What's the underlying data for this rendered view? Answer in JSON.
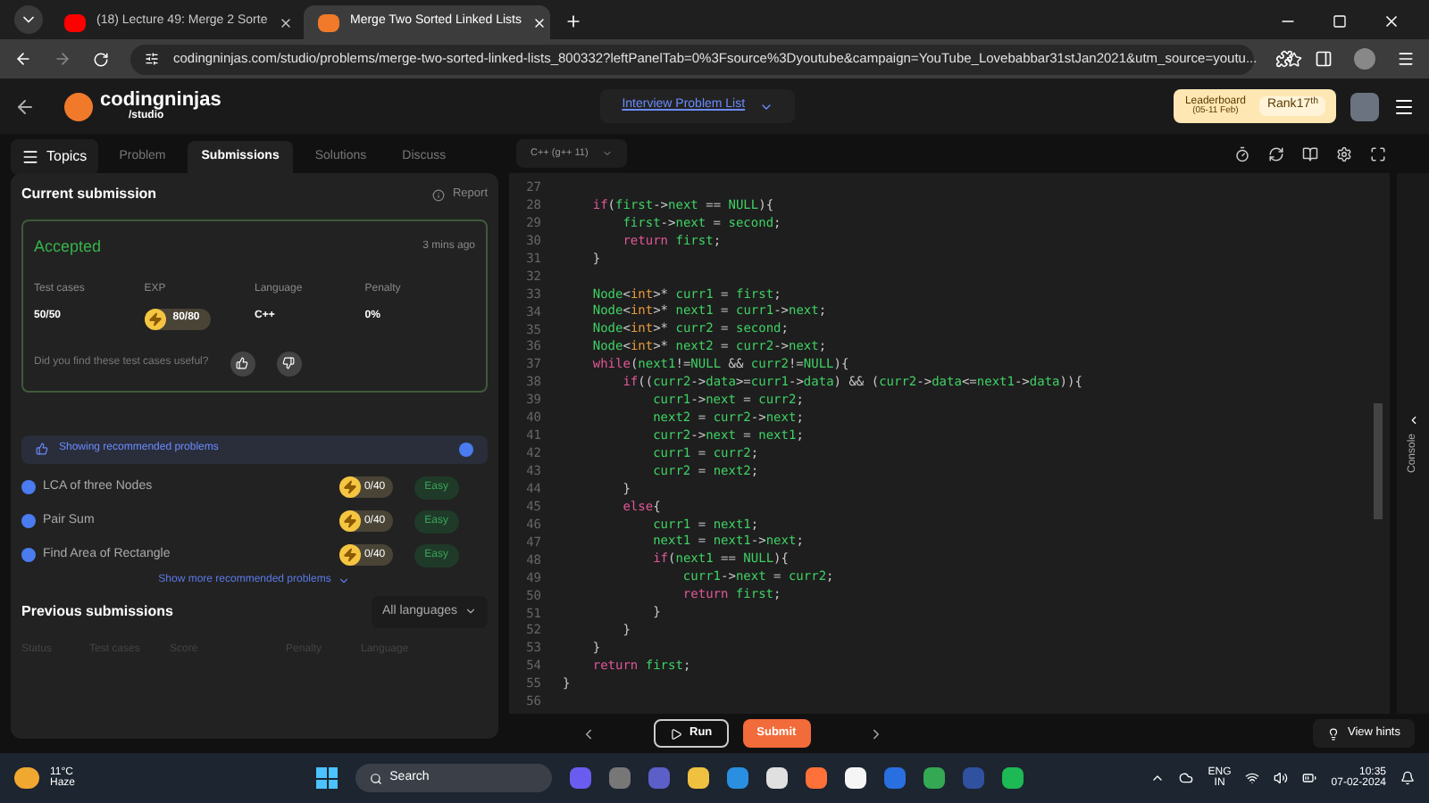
{
  "browser": {
    "tabs": [
      {
        "title": "(18) Lecture 49: Merge 2 Sorte",
        "selected": false
      },
      {
        "title": "Merge Two Sorted Linked Lists",
        "selected": true
      }
    ],
    "url": "codingninjas.com/studio/problems/merge-two-sorted-linked-lists_800332?leftPanelTab=0%3Fsource%3Dyoutube&campaign=YouTube_Lovebabbar31stJan2021&utm_source=youtu..."
  },
  "site_header": {
    "logo_name": "codingninjas",
    "logo_sub": "/studio",
    "center_link": "Interview Problem List",
    "leaderboard": {
      "title": "Leaderboard",
      "dates": "(05-11 Feb)",
      "rank_label": "Rank",
      "rank_value": "17",
      "rank_suffix": "th"
    }
  },
  "left_panel": {
    "topics_button": "Topics",
    "tabs": [
      {
        "label": "Problem",
        "selected": false
      },
      {
        "label": "Submissions",
        "selected": true
      },
      {
        "label": "Solutions",
        "selected": false
      },
      {
        "label": "Discuss",
        "selected": false
      }
    ],
    "current_submission": {
      "title": "Current submission",
      "report": "Report",
      "status": "Accepted",
      "time": "3 mins ago",
      "stats": [
        {
          "label": "Test cases",
          "value": "50/50",
          "kind": "text"
        },
        {
          "label": "EXP",
          "value": "80/80",
          "kind": "coin"
        },
        {
          "label": "Language",
          "value": "C++",
          "kind": "text"
        },
        {
          "label": "Penalty",
          "value": "0%",
          "kind": "text"
        }
      ],
      "feedback_question": "Did you find these test cases useful?"
    },
    "recommended": {
      "banner": "Showing recommended problems",
      "checked": true,
      "problems": [
        {
          "name": "LCA of three Nodes",
          "exp": "0/40",
          "difficulty": "Easy"
        },
        {
          "name": "Pair Sum",
          "exp": "0/40",
          "difficulty": "Easy"
        },
        {
          "name": "Find Area of Rectangle",
          "exp": "0/40",
          "difficulty": "Easy"
        }
      ],
      "show_more": "Show more recommended problems"
    },
    "previous_submissions": {
      "title": "Previous submissions",
      "filter": "All languages",
      "columns": [
        "Status",
        "Test cases",
        "Score",
        "Penalty",
        "Language"
      ]
    }
  },
  "editor": {
    "language": "C++ (g++ 11)",
    "console_label": "Console",
    "lines": [
      {
        "number": "27"
      },
      {
        "number": "28",
        "tokens": [
          {
            "kind": "kw",
            "text": "    if"
          },
          {
            "kind": "p",
            "text": "("
          },
          {
            "kind": "id",
            "text": "first"
          },
          {
            "kind": "p",
            "text": "->"
          },
          {
            "kind": "id",
            "text": "next"
          },
          {
            "kind": "p",
            "text": " == "
          },
          {
            "kind": "id",
            "text": "NULL"
          },
          {
            "kind": "p",
            "text": "){"
          }
        ]
      },
      {
        "number": "29",
        "tokens": [
          {
            "kind": "id",
            "text": "        first"
          },
          {
            "kind": "p",
            "text": "->"
          },
          {
            "kind": "id",
            "text": "next"
          },
          {
            "kind": "p",
            "text": " = "
          },
          {
            "kind": "id",
            "text": "second"
          },
          {
            "kind": "p",
            "text": ";"
          }
        ]
      },
      {
        "number": "30",
        "tokens": [
          {
            "kind": "kw",
            "text": "        return"
          },
          {
            "kind": "id",
            "text": " first"
          },
          {
            "kind": "p",
            "text": ";"
          }
        ]
      },
      {
        "number": "31",
        "tokens": [
          {
            "kind": "p",
            "text": "    }"
          }
        ]
      },
      {
        "number": "32"
      },
      {
        "number": "33",
        "tokens": [
          {
            "kind": "id",
            "text": "    Node"
          },
          {
            "kind": "p",
            "text": "<"
          },
          {
            "kind": "ty",
            "text": "int"
          },
          {
            "kind": "p",
            "text": ">* "
          },
          {
            "kind": "id",
            "text": "curr1"
          },
          {
            "kind": "p",
            "text": " = "
          },
          {
            "kind": "id",
            "text": "first"
          },
          {
            "kind": "p",
            "text": ";"
          }
        ]
      },
      {
        "number": "34",
        "tokens": [
          {
            "kind": "id",
            "text": "    Node"
          },
          {
            "kind": "p",
            "text": "<"
          },
          {
            "kind": "ty",
            "text": "int"
          },
          {
            "kind": "p",
            "text": ">* "
          },
          {
            "kind": "id",
            "text": "next1"
          },
          {
            "kind": "p",
            "text": " = "
          },
          {
            "kind": "id",
            "text": "curr1"
          },
          {
            "kind": "p",
            "text": "->"
          },
          {
            "kind": "id",
            "text": "next"
          },
          {
            "kind": "p",
            "text": ";"
          }
        ]
      },
      {
        "number": "35",
        "tokens": [
          {
            "kind": "id",
            "text": "    Node"
          },
          {
            "kind": "p",
            "text": "<"
          },
          {
            "kind": "ty",
            "text": "int"
          },
          {
            "kind": "p",
            "text": ">* "
          },
          {
            "kind": "id",
            "text": "curr2"
          },
          {
            "kind": "p",
            "text": " = "
          },
          {
            "kind": "id",
            "text": "second"
          },
          {
            "kind": "p",
            "text": ";"
          }
        ]
      },
      {
        "number": "36",
        "tokens": [
          {
            "kind": "id",
            "text": "    Node"
          },
          {
            "kind": "p",
            "text": "<"
          },
          {
            "kind": "ty",
            "text": "int"
          },
          {
            "kind": "p",
            "text": ">* "
          },
          {
            "kind": "id",
            "text": "next2"
          },
          {
            "kind": "p",
            "text": " = "
          },
          {
            "kind": "id",
            "text": "curr2"
          },
          {
            "kind": "p",
            "text": "->"
          },
          {
            "kind": "id",
            "text": "next"
          },
          {
            "kind": "p",
            "text": ";"
          }
        ]
      },
      {
        "number": "37",
        "tokens": [
          {
            "kind": "kw",
            "text": "    while"
          },
          {
            "kind": "p",
            "text": "("
          },
          {
            "kind": "id",
            "text": "next1"
          },
          {
            "kind": "p",
            "text": "!="
          },
          {
            "kind": "id",
            "text": "NULL"
          },
          {
            "kind": "p",
            "text": " && "
          },
          {
            "kind": "id",
            "text": "curr2"
          },
          {
            "kind": "p",
            "text": "!="
          },
          {
            "kind": "id",
            "text": "NULL"
          },
          {
            "kind": "p",
            "text": "){"
          }
        ]
      },
      {
        "number": "38",
        "tokens": [
          {
            "kind": "kw",
            "text": "        if"
          },
          {
            "kind": "p",
            "text": "(("
          },
          {
            "kind": "id",
            "text": "curr2"
          },
          {
            "kind": "p",
            "text": "->"
          },
          {
            "kind": "id",
            "text": "data"
          },
          {
            "kind": "p",
            "text": ">="
          },
          {
            "kind": "id",
            "text": "curr1"
          },
          {
            "kind": "p",
            "text": "->"
          },
          {
            "kind": "id",
            "text": "data"
          },
          {
            "kind": "p",
            "text": ") && ("
          },
          {
            "kind": "id",
            "text": "curr2"
          },
          {
            "kind": "p",
            "text": "->"
          },
          {
            "kind": "id",
            "text": "data"
          },
          {
            "kind": "p",
            "text": "<="
          },
          {
            "kind": "id",
            "text": "next1"
          },
          {
            "kind": "p",
            "text": "->"
          },
          {
            "kind": "id",
            "text": "data"
          },
          {
            "kind": "p",
            "text": ")){"
          }
        ]
      },
      {
        "number": "39",
        "tokens": [
          {
            "kind": "id",
            "text": "            curr1"
          },
          {
            "kind": "p",
            "text": "->"
          },
          {
            "kind": "id",
            "text": "next"
          },
          {
            "kind": "p",
            "text": " = "
          },
          {
            "kind": "id",
            "text": "curr2"
          },
          {
            "kind": "p",
            "text": ";"
          }
        ]
      },
      {
        "number": "40",
        "tokens": [
          {
            "kind": "id",
            "text": "            next2"
          },
          {
            "kind": "p",
            "text": " = "
          },
          {
            "kind": "id",
            "text": "curr2"
          },
          {
            "kind": "p",
            "text": "->"
          },
          {
            "kind": "id",
            "text": "next"
          },
          {
            "kind": "p",
            "text": ";"
          }
        ]
      },
      {
        "number": "41",
        "tokens": [
          {
            "kind": "id",
            "text": "            curr2"
          },
          {
            "kind": "p",
            "text": "->"
          },
          {
            "kind": "id",
            "text": "next"
          },
          {
            "kind": "p",
            "text": " = "
          },
          {
            "kind": "id",
            "text": "next1"
          },
          {
            "kind": "p",
            "text": ";"
          }
        ]
      },
      {
        "number": "42",
        "tokens": [
          {
            "kind": "id",
            "text": "            curr1"
          },
          {
            "kind": "p",
            "text": " = "
          },
          {
            "kind": "id",
            "text": "curr2"
          },
          {
            "kind": "p",
            "text": ";"
          }
        ]
      },
      {
        "number": "43",
        "tokens": [
          {
            "kind": "id",
            "text": "            curr2"
          },
          {
            "kind": "p",
            "text": " = "
          },
          {
            "kind": "id",
            "text": "next2"
          },
          {
            "kind": "p",
            "text": ";"
          }
        ]
      },
      {
        "number": "44",
        "tokens": [
          {
            "kind": "p",
            "text": "        }"
          }
        ]
      },
      {
        "number": "45",
        "tokens": [
          {
            "kind": "kw",
            "text": "        else"
          },
          {
            "kind": "p",
            "text": "{"
          }
        ]
      },
      {
        "number": "46",
        "tokens": [
          {
            "kind": "id",
            "text": "            curr1"
          },
          {
            "kind": "p",
            "text": " = "
          },
          {
            "kind": "id",
            "text": "next1"
          },
          {
            "kind": "p",
            "text": ";"
          }
        ]
      },
      {
        "number": "47",
        "tokens": [
          {
            "kind": "id",
            "text": "            next1"
          },
          {
            "kind": "p",
            "text": " = "
          },
          {
            "kind": "id",
            "text": "next1"
          },
          {
            "kind": "p",
            "text": "->"
          },
          {
            "kind": "id",
            "text": "next"
          },
          {
            "kind": "p",
            "text": ";"
          }
        ]
      },
      {
        "number": "48",
        "tokens": [
          {
            "kind": "kw",
            "text": "            if"
          },
          {
            "kind": "p",
            "text": "("
          },
          {
            "kind": "id",
            "text": "next1"
          },
          {
            "kind": "p",
            "text": " == "
          },
          {
            "kind": "id",
            "text": "NULL"
          },
          {
            "kind": "p",
            "text": "){"
          }
        ]
      },
      {
        "number": "49",
        "tokens": [
          {
            "kind": "id",
            "text": "                curr1"
          },
          {
            "kind": "p",
            "text": "->"
          },
          {
            "kind": "id",
            "text": "next"
          },
          {
            "kind": "p",
            "text": " = "
          },
          {
            "kind": "id",
            "text": "curr2"
          },
          {
            "kind": "p",
            "text": ";"
          }
        ]
      },
      {
        "number": "50",
        "tokens": [
          {
            "kind": "kw",
            "text": "                return"
          },
          {
            "kind": "id",
            "text": " first"
          },
          {
            "kind": "p",
            "text": ";"
          }
        ]
      },
      {
        "number": "51",
        "tokens": [
          {
            "kind": "p",
            "text": "            }"
          }
        ]
      },
      {
        "number": "52",
        "tokens": [
          {
            "kind": "p",
            "text": "        }"
          }
        ]
      },
      {
        "number": "53",
        "tokens": [
          {
            "kind": "p",
            "text": "    }"
          }
        ]
      },
      {
        "number": "54",
        "tokens": [
          {
            "kind": "kw",
            "text": "    return"
          },
          {
            "kind": "id",
            "text": " first"
          },
          {
            "kind": "p",
            "text": ";"
          }
        ]
      },
      {
        "number": "55",
        "tokens": [
          {
            "kind": "p",
            "text": "}"
          }
        ]
      },
      {
        "number": "56"
      }
    ]
  },
  "bottom_bar": {
    "run": "Run",
    "submit": "Submit",
    "hints": "View hints"
  },
  "taskbar": {
    "weather_temp": "11°C",
    "weather_desc": "Haze",
    "search": "Search",
    "lang_top": "ENG",
    "lang_bottom": "IN",
    "time": "10:35",
    "date": "07-02-2024"
  }
}
